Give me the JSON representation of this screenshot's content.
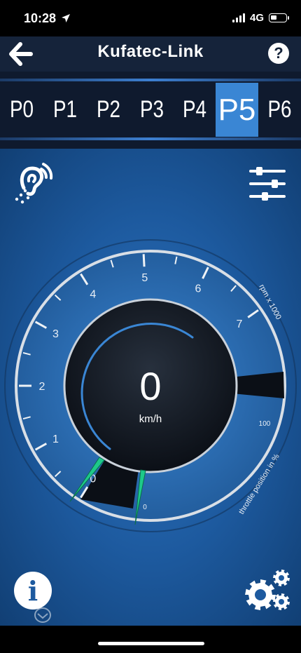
{
  "status": {
    "time": "10:28",
    "network": "4G",
    "location_icon": "location-arrow-icon"
  },
  "header": {
    "title": "Kufatec-Link",
    "back_icon": "arrow-left-icon",
    "help_label": "?"
  },
  "presets": {
    "tabs": [
      {
        "label": "P0",
        "active": false
      },
      {
        "label": "P1",
        "active": false
      },
      {
        "label": "P2",
        "active": false
      },
      {
        "label": "P3",
        "active": false
      },
      {
        "label": "P4",
        "active": false
      },
      {
        "label": "P5",
        "active": true
      },
      {
        "label": "P6",
        "active": false
      }
    ]
  },
  "toolbar": {
    "sound_icon": "hearing-icon",
    "sliders_icon": "sliders-icon"
  },
  "gauge": {
    "speed_value": "0",
    "speed_unit": "km/h",
    "rpm_label": "rpm x 1000",
    "rpm_ticks": [
      "0",
      "1",
      "2",
      "3",
      "4",
      "5",
      "6",
      "7"
    ],
    "throttle_label": "throttle position in %",
    "throttle_min": "0",
    "throttle_max": "100",
    "rpm_value": 0,
    "throttle_value": 0,
    "needle_color": "#1ec98a",
    "accent_color": "#3a86d4"
  },
  "footer": {
    "info_label": "i",
    "settings_icon": "gears-icon"
  }
}
